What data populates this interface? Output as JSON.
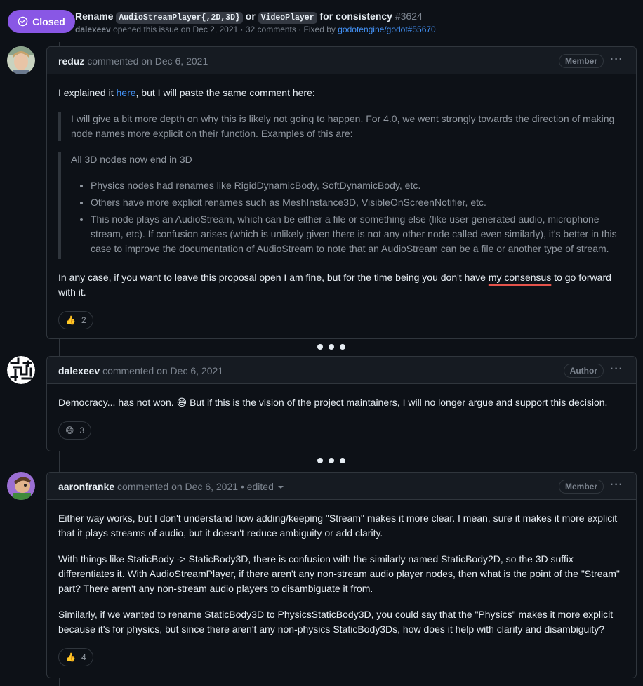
{
  "issue": {
    "state": "Closed",
    "title_prefix": "Rename",
    "code1": "AudioStreamPlayer{,2D,3D}",
    "or_text": "or",
    "code2": "VideoPlayer",
    "title_suffix": "for consistency",
    "number": "#3624",
    "author": "dalexeev",
    "meta_text": "opened this issue on Dec 2, 2021 · 32 comments · Fixed by",
    "fixed_by": "godotengine/godot#55670",
    "colors": {
      "closed": "#8957e5",
      "link": "#4493f8",
      "squiggle": "#e5534b"
    }
  },
  "comments": [
    {
      "author": "reduz",
      "action": "commented on Dec 6, 2021",
      "role": "Member",
      "avatar": "avatar-reduz",
      "intro_before": "I explained it ",
      "intro_link": "here",
      "intro_after": ", but I will paste the same comment here:",
      "quote_p1": "I will give a bit more depth on why this is likely not going to happen. For 4.0, we went strongly towards the direction of making node names more explicit on their function. Examples of this are:",
      "quote_p2": "All 3D nodes now end in 3D",
      "quote_items": [
        "Physics nodes had renames like RigidDynamicBody, SoftDynamicBody, etc.",
        "Others have more explicit renames such as MeshInstance3D, VisibleOnScreenNotifier, etc.",
        "This node plays an AudioStream, which can be either a file or something else (like user generated audio, microphone stream, etc). If confusion arises (which is unlikely given there is not any other node called even similarly), it's better in this case to improve the documentation of AudioStream to note that an AudioStream can be a file or another type of stream."
      ],
      "closing_before": "In any case, if you want to leave this proposal open I am fine, but for the time being you don't have ",
      "closing_marked": "my consensus",
      "closing_after": " to go forward with it.",
      "reaction_emoji": "👍",
      "reaction_count": "2"
    },
    {
      "author": "dalexeev",
      "action": "commented on Dec 6, 2021",
      "role": "Author",
      "avatar": "avatar-maze",
      "text_before": "Democracy... has not won. ",
      "text_emoji": "😄",
      "text_after": " But if this is the vision of the project maintainers, I will no longer argue and support this decision.",
      "reaction_emoji": "😄",
      "reaction_count": "3"
    },
    {
      "author": "aaronfranke",
      "action": "commented on Dec 6, 2021",
      "edited": "• edited",
      "role": "Member",
      "avatar": "avatar-aaronfranke",
      "paragraphs": [
        "Either way works, but I don't understand how adding/keeping \"Stream\" makes it more clear. I mean, sure it makes it more explicit that it plays streams of audio, but it doesn't reduce ambiguity or add clarity.",
        "With things like StaticBody -> StaticBody3D, there is confusion with the similarly named StaticBody2D, so the 3D suffix differentiates it. With AudioStreamPlayer, if there aren't any non-stream audio player nodes, then what is the point of the \"Stream\" part? There aren't any non-stream audio players to disambiguate it from.",
        "Similarly, if we wanted to rename StaticBody3D to PhysicsStaticBody3D, you could say that the \"Physics\" makes it more explicit because it's for physics, but since there aren't any non-physics StaticBody3Ds, how does it help with clarity and disambiguity?"
      ],
      "reaction_emoji": "👍",
      "reaction_count": "4"
    }
  ]
}
